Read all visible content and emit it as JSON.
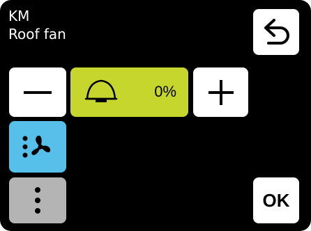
{
  "header": {
    "line1": "KM",
    "line2": "Roof fan"
  },
  "controls": {
    "level_value": "0%",
    "back_icon": "undo-arrow-icon",
    "decrease_icon": "minus-icon",
    "increase_icon": "plus-icon",
    "level_icon": "bell-icon",
    "mode_icon": "fan-icon",
    "more_icon": "vertical-dots-icon",
    "ok_label": "OK"
  },
  "colors": {
    "background": "#000000",
    "level_panel": "#c7d62d",
    "fan_button": "#56bfea",
    "more_button": "#b4b4b4"
  }
}
